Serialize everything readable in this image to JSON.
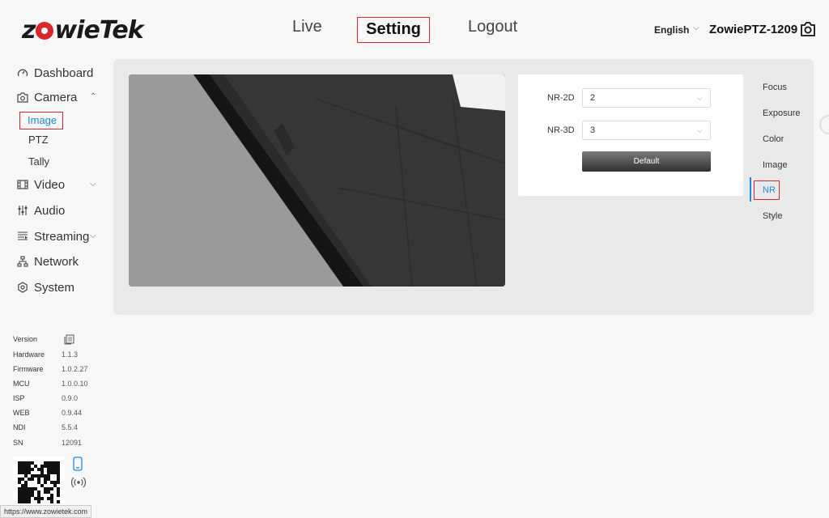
{
  "header": {
    "logo_text": "ZowieTek",
    "nav": {
      "live": "Live",
      "setting": "Setting",
      "logout": "Logout"
    },
    "language": "English",
    "device_name": "ZowiePTZ-1209"
  },
  "sidebar": {
    "items": [
      {
        "label": "Dashboard",
        "icon": "dashboard-icon"
      },
      {
        "label": "Camera",
        "icon": "camera-icon"
      },
      {
        "label": "Video",
        "icon": "video-icon"
      },
      {
        "label": "Audio",
        "icon": "audio-icon"
      },
      {
        "label": "Streaming",
        "icon": "streaming-icon"
      },
      {
        "label": "Network",
        "icon": "network-icon"
      },
      {
        "label": "System",
        "icon": "system-icon"
      }
    ],
    "camera_sub": [
      "Image",
      "PTZ",
      "Tally"
    ]
  },
  "version": {
    "title": "Version",
    "rows": [
      {
        "label": "Hardware",
        "value": "1.1.3"
      },
      {
        "label": "Firmware",
        "value": "1.0.2.27"
      },
      {
        "label": "MCU",
        "value": "1.0.0.10"
      },
      {
        "label": "ISP",
        "value": "0.9.0"
      },
      {
        "label": "WEB",
        "value": "0.9.44"
      },
      {
        "label": "NDI",
        "value": "5.5.4"
      },
      {
        "label": "SN",
        "value": "12091"
      }
    ]
  },
  "status_url": "https://www.zowietek.com",
  "nr_settings": {
    "nr2d_label": "NR-2D",
    "nr2d_value": "2",
    "nr3d_label": "NR-3D",
    "nr3d_value": "3",
    "default_button": "Default"
  },
  "right_nav": [
    "Focus",
    "Exposure",
    "Color",
    "Image",
    "NR",
    "Style"
  ],
  "colors": {
    "accent_blue": "#1e88e5",
    "highlight_red": "#d9262c"
  }
}
